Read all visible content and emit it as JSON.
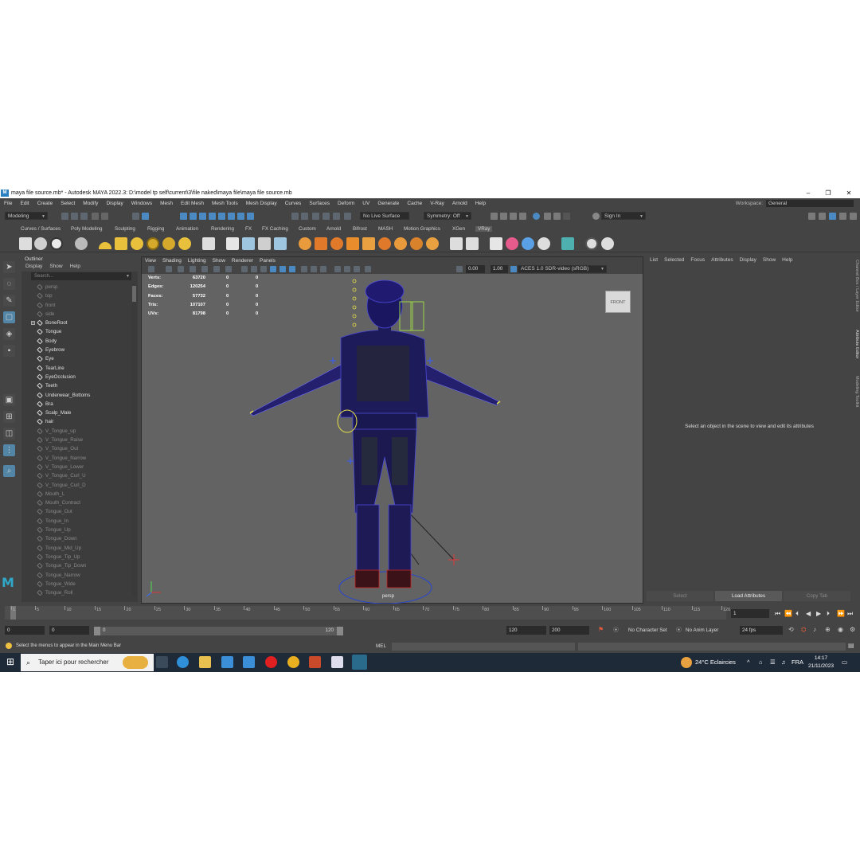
{
  "window": {
    "title": "maya file source.mb* - Autodesk MAYA 2022.3: D:\\model tp self\\current\\3\\file naked\\maya file\\maya file source.mb",
    "app_icon": "M"
  },
  "menu": [
    "File",
    "Edit",
    "Create",
    "Select",
    "Modify",
    "Display",
    "Windows",
    "Mesh",
    "Edit Mesh",
    "Mesh Tools",
    "Mesh Display",
    "Curves",
    "Surfaces",
    "Deform",
    "UV",
    "Generate",
    "Cache",
    "V-Ray",
    "Arnold",
    "Help"
  ],
  "workspace": {
    "label": "Workspace:",
    "value": "General"
  },
  "statusline": {
    "mode": "Modeling",
    "live_surface": "No Live Surface",
    "symmetry": "Symmetry: Off",
    "sign_in": "Sign In"
  },
  "shelf_tabs": [
    "Curves / Surfaces",
    "Poly Modeling",
    "Sculpting",
    "Rigging",
    "Animation",
    "Rendering",
    "FX",
    "FX Caching",
    "Custom",
    "Arnold",
    "Bifrost",
    "MASH",
    "Motion Graphics",
    "XGen",
    "VRay"
  ],
  "shelf_active": "VRay",
  "outliner": {
    "title": "Outliner",
    "menu": [
      "Display",
      "Show",
      "Help"
    ],
    "search_placeholder": "Search...",
    "items": [
      {
        "name": "persp",
        "dim": true
      },
      {
        "name": "top",
        "dim": true
      },
      {
        "name": "front",
        "dim": true
      },
      {
        "name": "side",
        "dim": true
      },
      {
        "name": "BoneRoot",
        "dim": false,
        "expand": true
      },
      {
        "name": "Tongue",
        "dim": false
      },
      {
        "name": "Body",
        "dim": false
      },
      {
        "name": "Eyebrow",
        "dim": false
      },
      {
        "name": "Eye",
        "dim": false
      },
      {
        "name": "TearLine",
        "dim": false
      },
      {
        "name": "EyeOcclusion",
        "dim": false
      },
      {
        "name": "Teeth",
        "dim": false
      },
      {
        "name": "Underwear_Bottoms",
        "dim": false
      },
      {
        "name": "Bra",
        "dim": false
      },
      {
        "name": "Scalp_Male",
        "dim": false
      },
      {
        "name": "hair",
        "dim": false
      },
      {
        "name": "V_Tongue_up",
        "dim": true
      },
      {
        "name": "V_Tongue_Raise",
        "dim": true
      },
      {
        "name": "V_Tongue_Out",
        "dim": true
      },
      {
        "name": "V_Tongue_Narrow",
        "dim": true
      },
      {
        "name": "V_Tongue_Lower",
        "dim": true
      },
      {
        "name": "V_Tongue_Curl_U",
        "dim": true
      },
      {
        "name": "V_Tongue_Curl_D",
        "dim": true
      },
      {
        "name": "Mouth_L",
        "dim": true
      },
      {
        "name": "Mouth_Contract",
        "dim": true
      },
      {
        "name": "Tongue_Out",
        "dim": true
      },
      {
        "name": "Tongue_In",
        "dim": true
      },
      {
        "name": "Tongue_Up",
        "dim": true
      },
      {
        "name": "Tongue_Down",
        "dim": true
      },
      {
        "name": "Tongue_Mid_Up",
        "dim": true
      },
      {
        "name": "Tongue_Tip_Up",
        "dim": true
      },
      {
        "name": "Tongue_Tip_Down",
        "dim": true
      },
      {
        "name": "Tongue_Narrow",
        "dim": true
      },
      {
        "name": "Tongue_Wide",
        "dim": true
      },
      {
        "name": "Tongue_Roll",
        "dim": true
      }
    ]
  },
  "viewport": {
    "menu": [
      "View",
      "Shading",
      "Lighting",
      "Show",
      "Renderer",
      "Panels"
    ],
    "exposure": "0.00",
    "gamma": "1.00",
    "color_space": "ACES 1.0 SDR-video (sRGB)",
    "hud": [
      {
        "label": "Verts:",
        "v1": "63720",
        "v2": "0",
        "v3": "0"
      },
      {
        "label": "Edges:",
        "v1": "120254",
        "v2": "0",
        "v3": "0"
      },
      {
        "label": "Faces:",
        "v1": "57732",
        "v2": "0",
        "v3": "0"
      },
      {
        "label": "Tris:",
        "v1": "107107",
        "v2": "0",
        "v3": "0"
      },
      {
        "label": "UVs:",
        "v1": "81798",
        "v2": "0",
        "v3": "0"
      }
    ],
    "viewcube": "FRONT",
    "camera": "persp"
  },
  "attribute_editor": {
    "menu": [
      "List",
      "Selected",
      "Focus",
      "Attributes",
      "Display",
      "Show",
      "Help"
    ],
    "message": "Select an object in the scene to view and edit its attributes",
    "buttons": [
      "Select",
      "Load Attributes",
      "Copy Tab"
    ]
  },
  "side_tabs": [
    "Channel Box / Layer Editor",
    "Attribute Editor",
    "Modeling Toolkit"
  ],
  "timeline": {
    "ticks": [
      "1",
      "5",
      "10",
      "15",
      "20",
      "25",
      "30",
      "35",
      "40",
      "45",
      "50",
      "55",
      "60",
      "65",
      "70",
      "75",
      "80",
      "85",
      "90",
      "95",
      "100",
      "105",
      "110",
      "115",
      "120"
    ],
    "current_frame": "1"
  },
  "range": {
    "start": "0",
    "playback_start": "0",
    "range_start": "0",
    "range_end": "120",
    "playback_end": "120",
    "end": "200",
    "character_set": "No Character Set",
    "anim_layer": "No Anim Layer",
    "fps": "24 fps"
  },
  "help_line": "Select the menus to appear in the Main Menu Bar",
  "mel_label": "MEL",
  "taskbar": {
    "search_placeholder": "Taper ici pour rechercher",
    "weather": "24°C  Eclaircies",
    "lang": "FRA",
    "time": "14:17",
    "date": "21/11/2023"
  }
}
